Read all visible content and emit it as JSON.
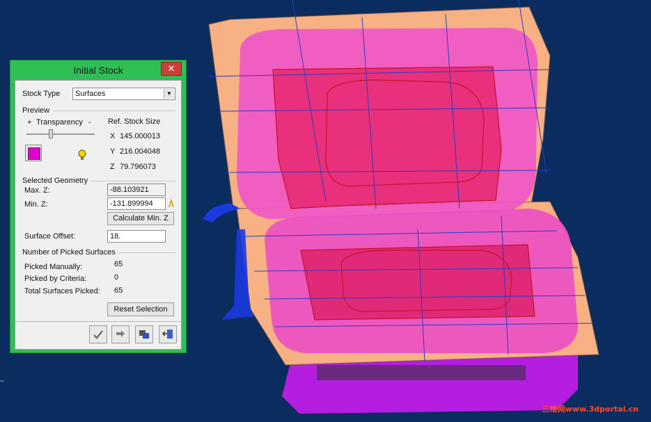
{
  "dialog": {
    "title": "Initial Stock",
    "close_glyph": "✕",
    "stock_type_label": "Stock Type",
    "stock_type_value": "Surfaces",
    "preview_label": "Preview",
    "transparency_plus": "+",
    "transparency_label": "Transparency",
    "transparency_minus": "-",
    "transparency_level": 0.35,
    "preview_color": "#e000d0",
    "ref_stock_size_label": "Ref. Stock Size",
    "x_label": "X",
    "x_value": "145.000013",
    "y_label": "Y",
    "y_value": "216.004048",
    "z_label": "Z",
    "z_value": "79.796073",
    "selected_geometry_label": "Selected Geometry",
    "max_z_label": "Max. Z:",
    "max_z_value": "-88.103921",
    "min_z_label": "Min. Z:",
    "min_z_value": "-131.899994",
    "calculate_min_z_label": "Calculate Min. Z",
    "surface_offset_label": "Surface Offset:",
    "surface_offset_value": "18.",
    "picked_surfaces_label": "Number of Picked Surfaces",
    "picked_manually_label": "Picked Manually:",
    "picked_manually_value": "65",
    "picked_by_criteria_label": "Picked by Criteria:",
    "picked_by_criteria_value": "0",
    "total_picked_label": "Total Surfaces Picked:",
    "total_picked_value": "65",
    "reset_selection_label": "Reset Selection",
    "icons": [
      "checkmark-icon",
      "pick-icon",
      "stock-list-icon",
      "exit-icon",
      "lightbulb-icon"
    ]
  },
  "watermark": "三维网www.3dportal.cn",
  "colors": {
    "background": "#0b2c5e",
    "dialog_frame": "#2fbf55",
    "part_orange": "#f5b080",
    "part_pink": "#f060c0",
    "part_purple": "#c020e0"
  }
}
